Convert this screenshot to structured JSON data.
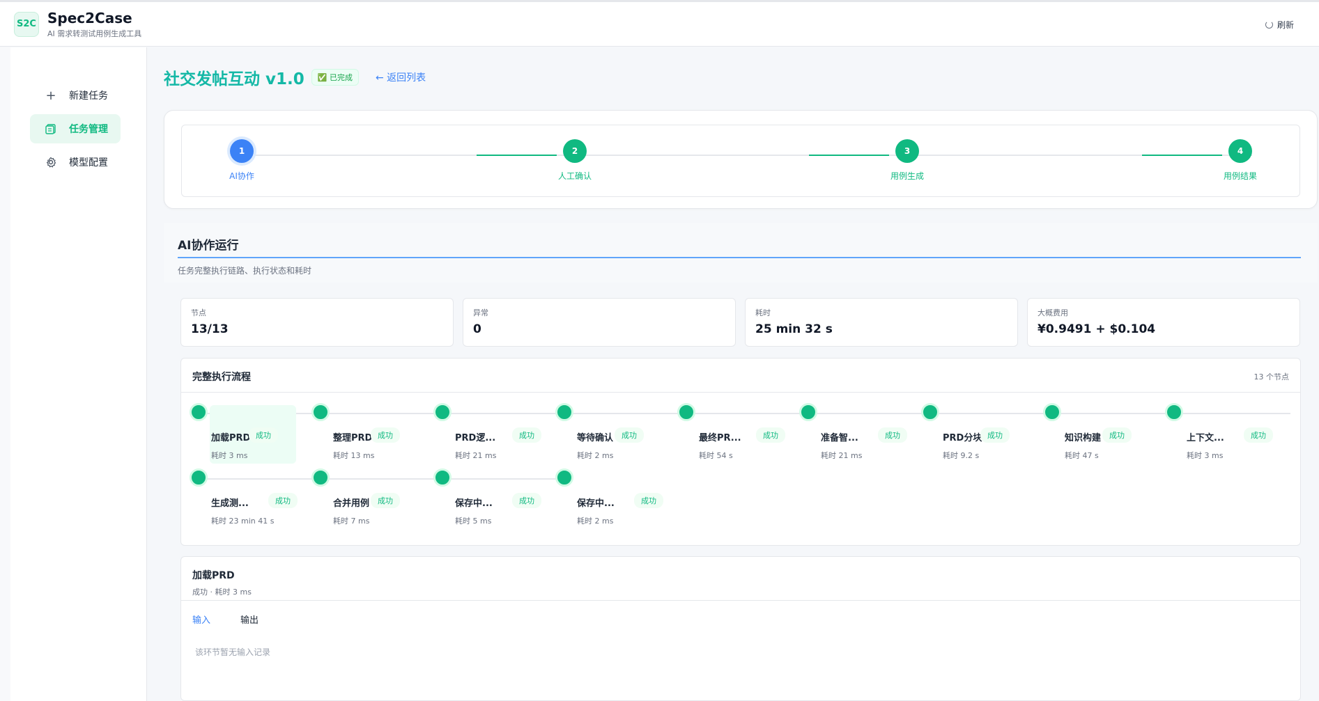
{
  "header": {
    "logo": "S2C",
    "app_name": "Spec2Case",
    "app_subtitle": "AI 需求转测试用例生成工具",
    "refresh_label": "刷新"
  },
  "sidebar": {
    "items": [
      {
        "label": "新建任务",
        "icon": "plus-icon"
      },
      {
        "label": "任务管理",
        "icon": "task-list-icon"
      },
      {
        "label": "模型配置",
        "icon": "gear-icon"
      }
    ]
  },
  "page": {
    "title": "社交发帖互动 v1.0",
    "status": "✅ 已完成",
    "back_label": "← 返回列表"
  },
  "steps": [
    {
      "num": "1",
      "label": "AI协作"
    },
    {
      "num": "2",
      "label": "人工确认"
    },
    {
      "num": "3",
      "label": "用例生成"
    },
    {
      "num": "4",
      "label": "用例结果"
    }
  ],
  "section": {
    "title": "AI协作运行",
    "desc": "任务完整执行链路、执行状态和耗时"
  },
  "stats": [
    {
      "label": "节点",
      "value": "13/13"
    },
    {
      "label": "异常",
      "value": "0"
    },
    {
      "label": "耗时",
      "value": "25 min 32 s"
    },
    {
      "label": "大概费用",
      "value": "¥0.9491 + $0.104"
    }
  ],
  "flow": {
    "title": "完整执行流程",
    "count": "13 个节点",
    "nodes": [
      {
        "name": "加载PRD",
        "status": "成功",
        "time": "耗时 3 ms"
      },
      {
        "name": "整理PRD",
        "status": "成功",
        "time": "耗时 13 ms"
      },
      {
        "name": "PRD逻...",
        "status": "成功",
        "time": "耗时 21 ms"
      },
      {
        "name": "等待确认",
        "status": "成功",
        "time": "耗时 2 ms"
      },
      {
        "name": "最终PR...",
        "status": "成功",
        "time": "耗时 54 s"
      },
      {
        "name": "准备智...",
        "status": "成功",
        "time": "耗时 21 ms"
      },
      {
        "name": "PRD分块",
        "status": "成功",
        "time": "耗时 9.2 s"
      },
      {
        "name": "知识构建",
        "status": "成功",
        "time": "耗时 47 s"
      },
      {
        "name": "上下文...",
        "status": "成功",
        "time": "耗时 3 ms"
      },
      {
        "name": "生成测...",
        "status": "成功",
        "time": "耗时 23 min 41 s"
      },
      {
        "name": "合并用例",
        "status": "成功",
        "time": "耗时 7 ms"
      },
      {
        "name": "保存中...",
        "status": "成功",
        "time": "耗时 5 ms"
      },
      {
        "name": "保存中...",
        "status": "成功",
        "time": "耗时 2 ms"
      }
    ]
  },
  "detail": {
    "title": "加载PRD",
    "sub": "成功 · 耗时 3 ms",
    "tabs": [
      "输入",
      "输出"
    ],
    "empty": "该环节暂无输入记录"
  }
}
